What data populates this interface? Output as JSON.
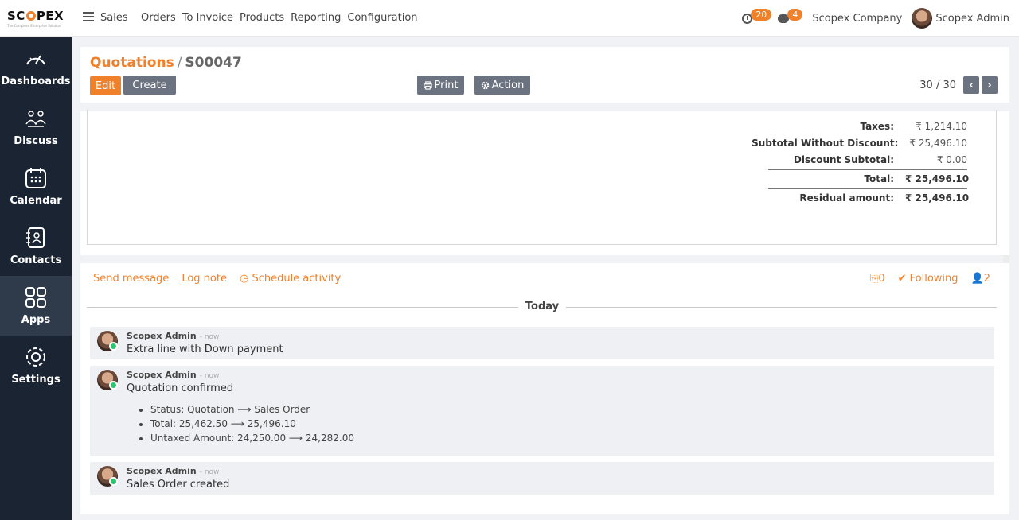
{
  "brand": {
    "logo_text_a": "SC",
    "logo_text_b": "PEX",
    "tagline": "The Complete Enterprise Solution",
    "accent": "#f0802a",
    "sidebar_bg": "#1b2433"
  },
  "topbar": {
    "app_name": "Sales",
    "menu": [
      "Orders",
      "To Invoice",
      "Products",
      "Reporting",
      "Configuration"
    ],
    "activity_count": "20",
    "message_count": "4",
    "company": "Scopex Company",
    "user": "Scopex Admin"
  },
  "sidebar": {
    "items": [
      {
        "label": "Dashboards",
        "icon": "dashboard-icon"
      },
      {
        "label": "Discuss",
        "icon": "discuss-icon"
      },
      {
        "label": "Calendar",
        "icon": "calendar-icon"
      },
      {
        "label": "Contacts",
        "icon": "contacts-icon"
      },
      {
        "label": "Apps",
        "icon": "apps-icon"
      },
      {
        "label": "Settings",
        "icon": "settings-icon"
      }
    ]
  },
  "control": {
    "breadcrumb_parent": "Quotations",
    "breadcrumb_sep": "/",
    "breadcrumb_current": "S00047",
    "edit": "Edit",
    "create": "Create",
    "print": "Print",
    "action": "Action",
    "pager": "30 / 30"
  },
  "totals": {
    "taxes_label": "Taxes:",
    "taxes": "₹ 1,214.10",
    "subtotal_wo_label": "Subtotal Without Discount:",
    "subtotal_wo": "₹ 25,496.10",
    "discount_label": "Discount Subtotal:",
    "discount": "₹ 0.00",
    "total_label": "Total:",
    "total": "₹ 25,496.10",
    "residual_label": "Residual amount:",
    "residual": "₹ 25,496.10"
  },
  "chatter": {
    "send_message": "Send message",
    "log_note": "Log note",
    "schedule_activity": "Schedule activity",
    "attachments": "0",
    "following": "Following",
    "followers": "2",
    "date_separator": "Today",
    "messages": [
      {
        "author": "Scopex Admin",
        "time": "- now",
        "body": "Extra line with Down payment"
      },
      {
        "author": "Scopex Admin",
        "time": "- now",
        "body": "Quotation confirmed",
        "changes": [
          "Status: Quotation ⟶ Sales Order",
          "Total: 25,462.50 ⟶ 25,496.10",
          "Untaxed Amount: 24,250.00 ⟶ 24,282.00"
        ]
      },
      {
        "author": "Scopex Admin",
        "time": "- now",
        "body": "Sales Order created"
      }
    ]
  }
}
